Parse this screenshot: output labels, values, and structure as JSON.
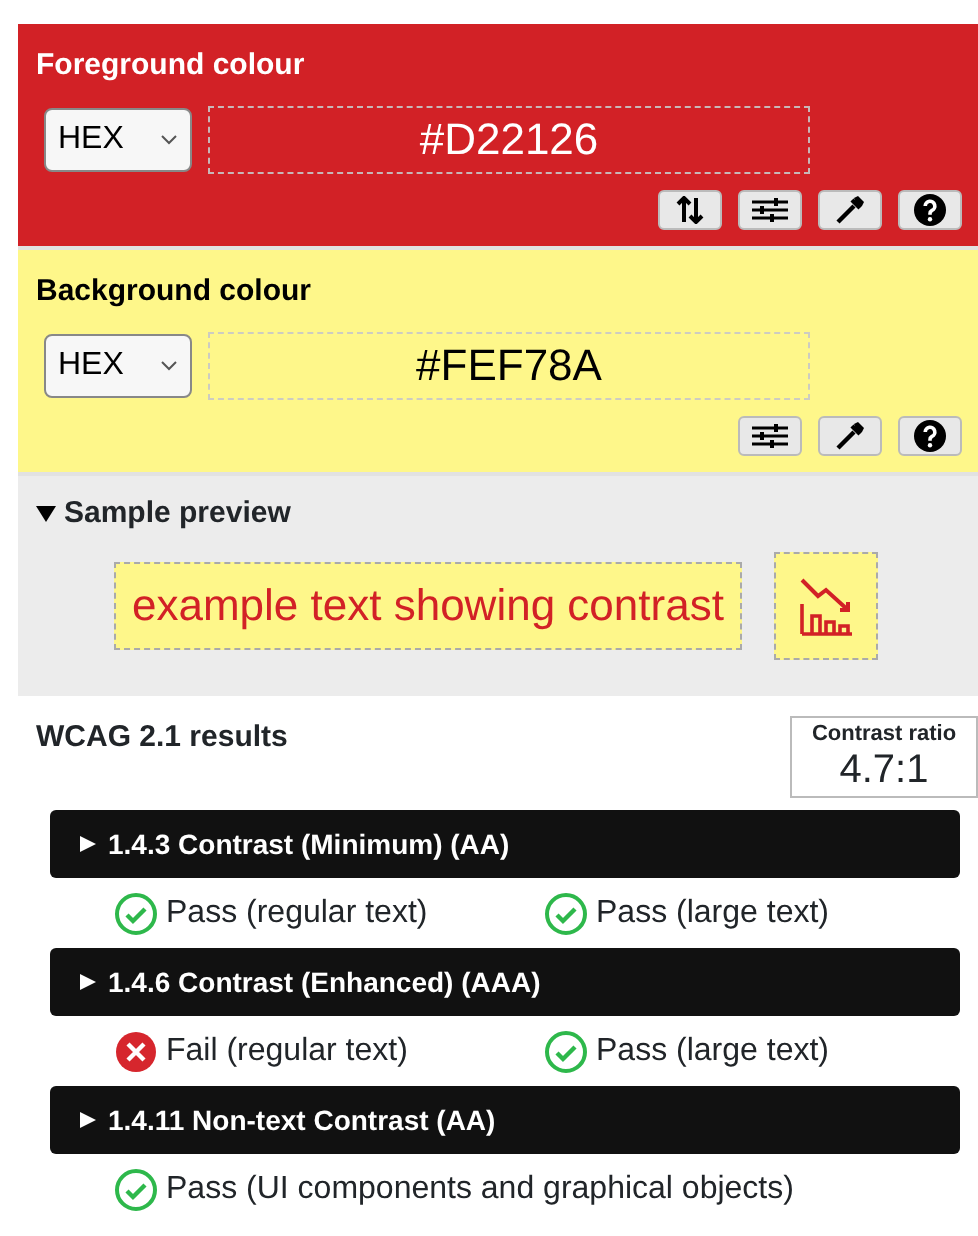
{
  "foreground": {
    "title": "Foreground colour",
    "format": "HEX",
    "value": "#D22126",
    "tools": [
      {
        "kind": "swap"
      },
      {
        "kind": "sliders"
      },
      {
        "kind": "picker"
      },
      {
        "kind": "help"
      }
    ]
  },
  "background": {
    "title": "Background colour",
    "format": "HEX",
    "value": "#FEF78A",
    "tools": [
      {
        "kind": "sliders"
      },
      {
        "kind": "picker"
      },
      {
        "kind": "help"
      }
    ]
  },
  "sample_preview": {
    "title": "Sample preview",
    "expanded": true,
    "sample_text": "example text showing contrast"
  },
  "results": {
    "title": "WCAG 2.1 results",
    "contrast_ratio_label": "Contrast ratio",
    "contrast_ratio": "4.7:1",
    "criteria": [
      {
        "title": "1.4.3 Contrast (Minimum) (AA)",
        "expanded": false,
        "outcomes": [
          {
            "passed": true,
            "label": "Pass (regular text)"
          },
          {
            "passed": true,
            "label": "Pass (large text)"
          }
        ]
      },
      {
        "title": "1.4.6 Contrast (Enhanced) (AAA)",
        "expanded": false,
        "outcomes": [
          {
            "passed": false,
            "label": "Fail (regular text)"
          },
          {
            "passed": true,
            "label": "Pass (large text)"
          }
        ]
      },
      {
        "title": "1.4.11 Non-text Contrast (AA)",
        "expanded": false,
        "outcomes": [
          {
            "passed": true,
            "label": "Pass (UI components and graphical objects)"
          }
        ]
      }
    ]
  }
}
